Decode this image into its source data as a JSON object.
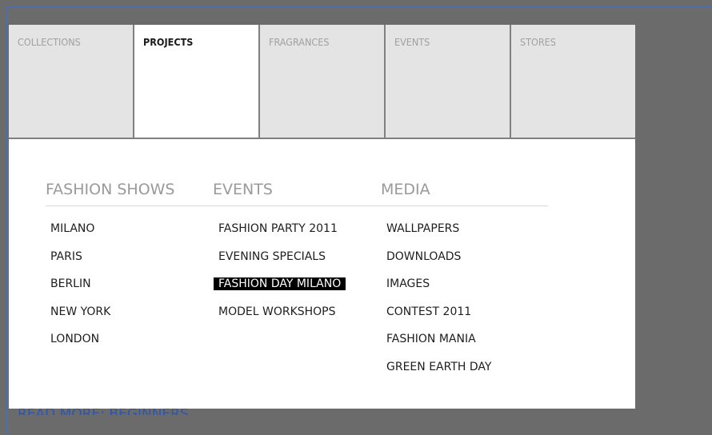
{
  "tabs": [
    {
      "label": "COLLECTIONS",
      "active": false
    },
    {
      "label": "PROJECTS",
      "active": true
    },
    {
      "label": "FRAGRANCES",
      "active": false
    },
    {
      "label": "EVENTS",
      "active": false
    },
    {
      "label": "STORES",
      "active": false
    }
  ],
  "columns": [
    {
      "heading": "FASHION SHOWS",
      "items": [
        "MILANO",
        "PARIS",
        "BERLIN",
        "NEW YORK",
        "LONDON"
      ]
    },
    {
      "heading": "EVENTS",
      "items": [
        "FASHION PARTY 2011",
        "EVENING SPECIALS",
        "FASHION DAY MILANO",
        "MODEL WORKSHOPS"
      ],
      "selected": "FASHION DAY MILANO"
    },
    {
      "heading": "MEDIA",
      "items": [
        "WALLPAPERS",
        "DOWNLOADS",
        "IMAGES",
        "CONTEST 2011",
        "FASHION MANIA",
        "GREEN EARTH DAY"
      ]
    }
  ],
  "background_link": "READ MORE: BEGINNERS",
  "colors": {
    "page_background": "#6b6b6b",
    "tab_inactive": "#e4e4e4",
    "tab_active": "#ffffff",
    "selected_item_bg": "#000000",
    "link": "#2f56a8"
  }
}
